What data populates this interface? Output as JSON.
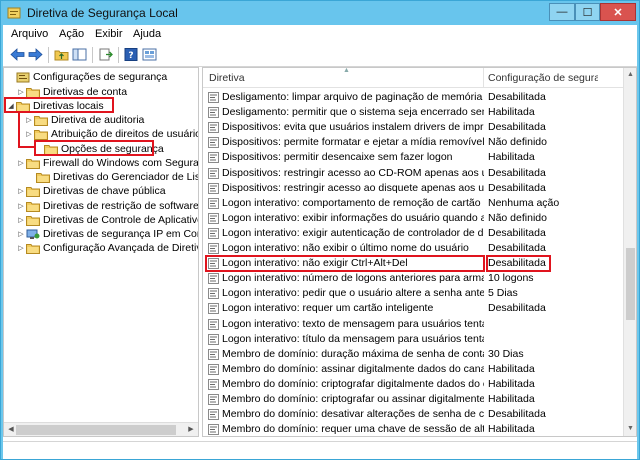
{
  "window": {
    "title": "Diretiva de Segurança Local",
    "minimize_glyph": "—",
    "maximize_glyph": "☐",
    "close_glyph": "✕",
    "frame_color": "#68c5ed"
  },
  "menu": [
    "Arquivo",
    "Ação",
    "Exibir",
    "Ajuda"
  ],
  "toolbar": {
    "buttons": [
      "back-arrow-icon",
      "forward-arrow-icon",
      "up-folder-icon",
      "show-hide-tree-icon",
      "export-list-icon",
      "help-icon",
      "properties-icon"
    ]
  },
  "tree": {
    "items": [
      {
        "label": "Configurações de segurança",
        "icon": "security-settings-icon",
        "expander": ""
      },
      {
        "label": "Diretivas de conta",
        "icon": "folder-icon",
        "expander": "▷"
      },
      {
        "label": "Diretivas locais",
        "icon": "folder-icon",
        "expander": "◢"
      },
      {
        "label": "Diretiva de auditoria",
        "icon": "folder-icon",
        "expander": "▷"
      },
      {
        "label": "Atribuição de direitos de usuário",
        "icon": "folder-icon",
        "expander": "▷"
      },
      {
        "label": "Opções de segurança",
        "icon": "folder-icon",
        "expander": ""
      },
      {
        "label": "Firewall do Windows com Segurança",
        "icon": "folder-icon",
        "expander": "▷"
      },
      {
        "label": "Diretivas do Gerenciador de Listas de",
        "icon": "folder-icon",
        "expander": ""
      },
      {
        "label": "Diretivas de chave pública",
        "icon": "folder-icon",
        "expander": "▷"
      },
      {
        "label": "Diretivas de restrição de software",
        "icon": "folder-icon",
        "expander": "▷"
      },
      {
        "label": "Diretivas de Controle de Aplicativo",
        "icon": "folder-icon",
        "expander": "▷"
      },
      {
        "label": "Diretivas de segurança IP em Comput",
        "icon": "ipsec-icon",
        "expander": "▷"
      },
      {
        "label": "Configuração Avançada de Diretiva d",
        "icon": "folder-icon",
        "expander": "▷"
      }
    ]
  },
  "list": {
    "columns": [
      "Diretiva",
      "Configuração de seguranç..."
    ],
    "rows": [
      {
        "policy": "Desligamento: limpar arquivo de paginação de memória virt...",
        "setting": "Desabilitada"
      },
      {
        "policy": "Desligamento: permitir que o sistema seja encerrado sem a ...",
        "setting": "Habilitada"
      },
      {
        "policy": "Dispositivos: evita que usuários instalem drivers de impresso...",
        "setting": "Desabilitada"
      },
      {
        "policy": "Dispositivos: permite formatar e ejetar a mídia removível",
        "setting": "Não definido"
      },
      {
        "policy": "Dispositivos: permitir desencaixe sem fazer logon",
        "setting": "Habilitada"
      },
      {
        "policy": "Dispositivos: restringir acesso ao CD-ROM apenas aos usuári...",
        "setting": "Desabilitada"
      },
      {
        "policy": "Dispositivos: restringir acesso ao disquete apenas aos usuár...",
        "setting": "Desabilitada"
      },
      {
        "policy": "Logon interativo: comportamento de remoção de cartão inte...",
        "setting": "Nenhuma ação"
      },
      {
        "policy": "Logon interativo: exibir informações do usuário quando a se...",
        "setting": "Não definido"
      },
      {
        "policy": "Logon interativo: exigir autenticação de controlador de dom...",
        "setting": "Desabilitada"
      },
      {
        "policy": "Logon interativo: não exibir o último nome do usuário",
        "setting": "Desabilitada"
      },
      {
        "policy": "Logon interativo: não exigir Ctrl+Alt+Del",
        "setting": "Desabilitada"
      },
      {
        "policy": "Logon interativo: número de logons anteriores para armaze...",
        "setting": "10 logons"
      },
      {
        "policy": "Logon interativo: pedir que o usuário altere a senha antes q...",
        "setting": "5 Dias"
      },
      {
        "policy": "Logon interativo: requer um cartão inteligente",
        "setting": "Desabilitada"
      },
      {
        "policy": "Logon interativo: texto de mensagem para usuários tentand...",
        "setting": ""
      },
      {
        "policy": "Logon interativo: título da mensagem para usuários tentand...",
        "setting": ""
      },
      {
        "policy": "Membro de domínio: duração máxima de senha de conta d...",
        "setting": "30 Dias"
      },
      {
        "policy": "Membro do domínio: assinar digitalmente dados do canal s...",
        "setting": "Habilitada"
      },
      {
        "policy": "Membro do domínio: criptografar digitalmente dados do ca...",
        "setting": "Habilitada"
      },
      {
        "policy": "Membro do domínio: criptografar ou assinar digitalmente d...",
        "setting": "Habilitada"
      },
      {
        "policy": "Membro do domínio: desativar alterações de senha de cont...",
        "setting": "Desabilitada"
      },
      {
        "policy": "Membro do domínio: requer uma chave de sessão de alta se...",
        "setting": "Habilitada"
      }
    ],
    "highlighted_row": "Logon interativo: não exigir Ctrl+Alt+Del"
  },
  "highlight_color": "#e0141e"
}
